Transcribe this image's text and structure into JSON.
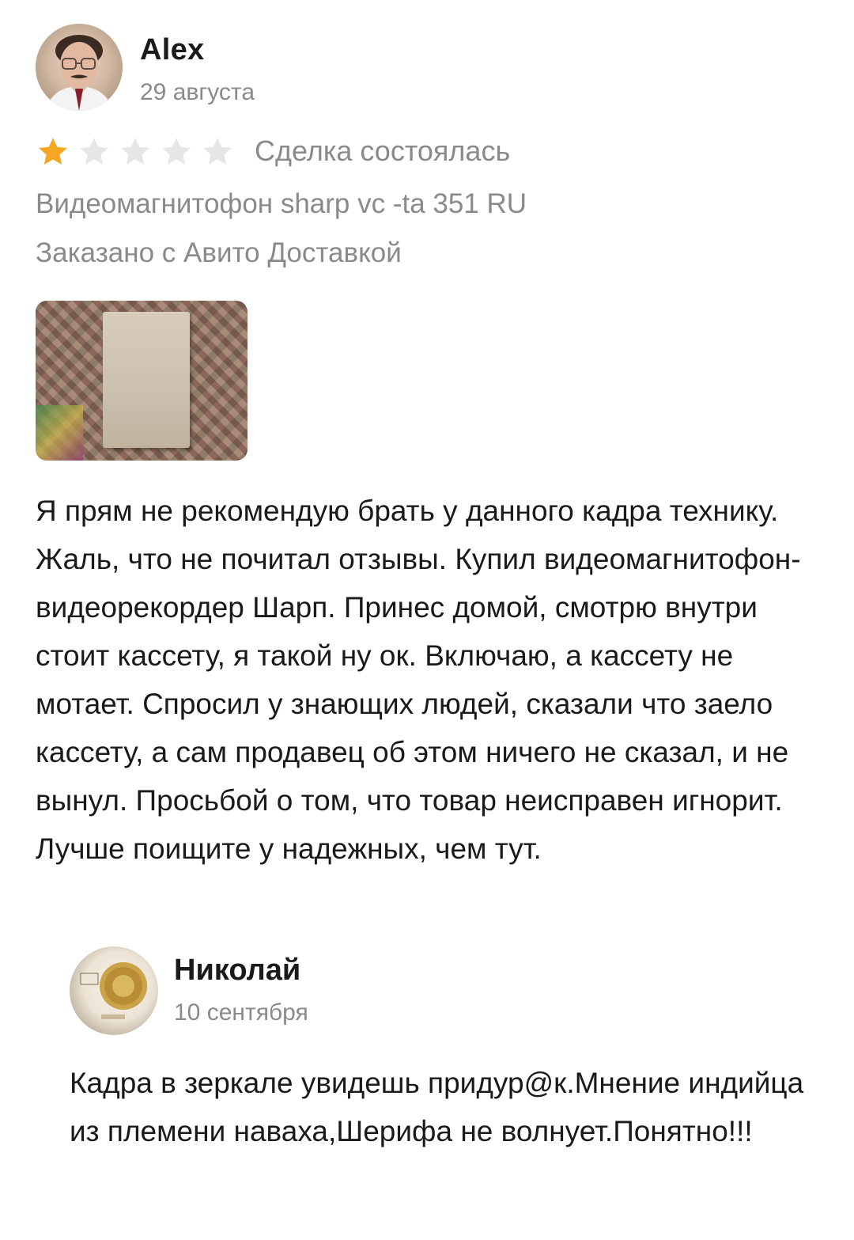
{
  "review": {
    "author": {
      "name": "Alex",
      "date": "29 августа"
    },
    "rating": {
      "value": 1,
      "max": 5,
      "filled_color": "#f5a623",
      "empty_color": "#e6e6e6"
    },
    "deal_status": "Сделка состоялась",
    "product": "Видеомагнитофон sharp vc -ta 351 RU",
    "delivery": "Заказано с Авито Доставкой",
    "text": "Я прям не рекомендую брать у данного кадра технику. Жаль, что не почитал отзывы. Купил видеомагнитофон-видеорекордер Шарп. Принес домой, смотрю внутри стоит кассету, я такой ну ок. Включаю, а кассету не мотает. Спросил у знающих людей, сказали что заело кассету, а сам продавец об этом ничего не сказал, и не вынул. Просьбой о том, что товар неисправен игнорит. Лучше поищите у надежных, чем тут."
  },
  "reply": {
    "author": {
      "name": "Николай",
      "date": "10 сентября"
    },
    "text": "Кадра в зеркале увидешь придур@к.Мнение индийца из племени наваха,Шерифа не волнует.Понятно!!!"
  },
  "colors": {
    "muted_text": "#8a8a8a",
    "primary_text": "#1a1a1a"
  }
}
